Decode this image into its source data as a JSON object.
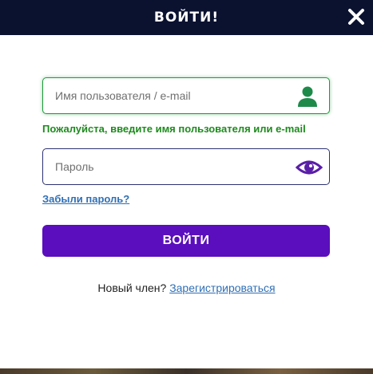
{
  "header": {
    "title": "ВОЙТИ!"
  },
  "username_field": {
    "placeholder": "Имя пользователя / e-mail",
    "value": ""
  },
  "error_message": "Пожалуйста, введите имя пользователя или e-mail",
  "password_field": {
    "placeholder": "Пароль",
    "value": ""
  },
  "forgot_password_label": "Забыли пароль?",
  "submit_label": "ВОЙТИ",
  "signup": {
    "prompt": "Новый член?",
    "link_label": "Зарегистрироваться"
  },
  "colors": {
    "header_bg": "#0b1230",
    "accent": "#5a0ebd",
    "success": "#1e8a1e",
    "link": "#2f6fb5"
  },
  "icons": {
    "close": "close-icon",
    "user": "user-icon",
    "eye": "eye-icon"
  }
}
